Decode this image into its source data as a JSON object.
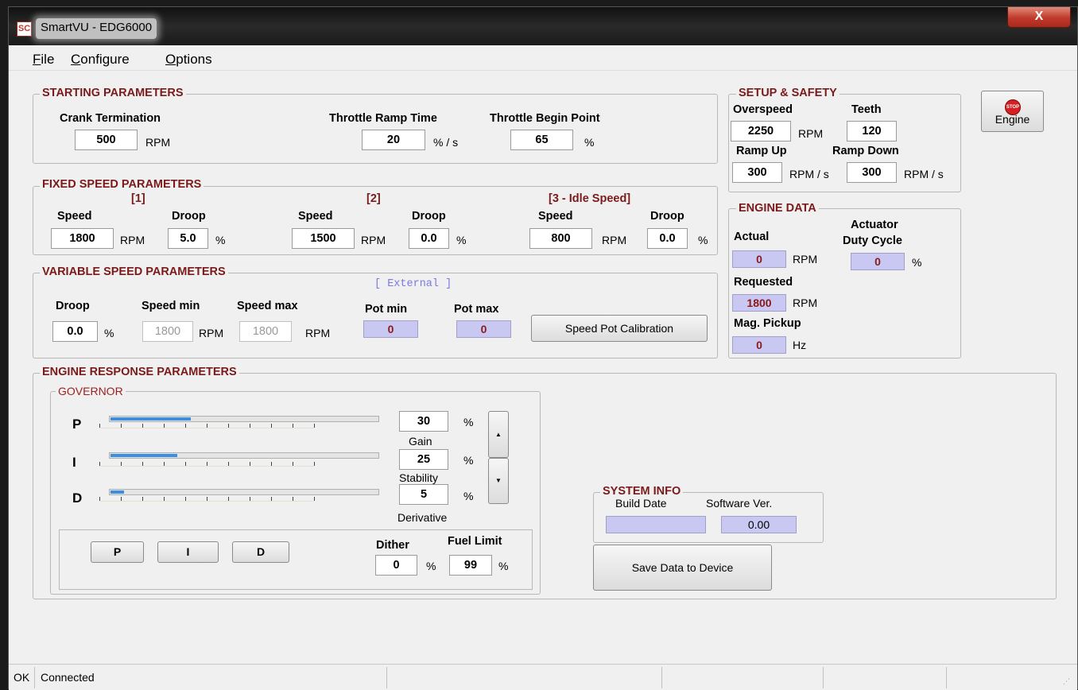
{
  "window": {
    "title": "SmartVU - EDG6000",
    "app_icon": "SC",
    "close": "X"
  },
  "menu": [
    {
      "label": "File",
      "mnemonic": "F"
    },
    {
      "label": "Configure",
      "mnemonic": "C"
    },
    {
      "label": "Options",
      "mnemonic": "O"
    }
  ],
  "starting": {
    "legend": "STARTING PARAMETERS",
    "crank_label": "Crank Termination",
    "crank_value": "500",
    "crank_unit": "RPM",
    "ramp_label": "Throttle Ramp Time",
    "ramp_value": "20",
    "ramp_unit": "% / s",
    "begin_label": "Throttle Begin Point",
    "begin_value": "65",
    "begin_unit": "%"
  },
  "setup": {
    "legend": "SETUP & SAFETY",
    "overspeed_label": "Overspeed",
    "overspeed_value": "2250",
    "overspeed_unit": "RPM",
    "teeth_label": "Teeth",
    "teeth_value": "120",
    "rampup_label": "Ramp Up",
    "rampup_value": "300",
    "rampup_unit": "RPM / s",
    "rampdown_label": "Ramp Down",
    "rampdown_value": "300",
    "rampdown_unit": "RPM / s"
  },
  "stop_engine": {
    "label": "Engine",
    "badge": "STOP"
  },
  "fixed": {
    "legend": "FIXED SPEED PARAMETERS",
    "sets": [
      {
        "title": "[1]",
        "speed_label": "Speed",
        "speed": "1800",
        "speed_unit": "RPM",
        "droop_label": "Droop",
        "droop": "5.0",
        "droop_unit": "%"
      },
      {
        "title": "[2]",
        "speed_label": "Speed",
        "speed": "1500",
        "speed_unit": "RPM",
        "droop_label": "Droop",
        "droop": "0.0",
        "droop_unit": "%"
      },
      {
        "title": "[3 - Idle Speed]",
        "speed_label": "Speed",
        "speed": "800",
        "speed_unit": "RPM",
        "droop_label": "Droop",
        "droop": "0.0",
        "droop_unit": "%"
      }
    ]
  },
  "engine_data": {
    "legend": "ENGINE DATA",
    "actual_label": "Actual",
    "actual_value": "0",
    "actual_unit": "RPM",
    "actuator_label_1": "Actuator",
    "actuator_label_2": "Duty Cycle",
    "actuator_value": "0",
    "actuator_unit": "%",
    "requested_label": "Requested",
    "requested_value": "1800",
    "requested_unit": "RPM",
    "mag_label": "Mag. Pickup",
    "mag_value": "0",
    "mag_unit": "Hz"
  },
  "variable": {
    "legend": "VARIABLE SPEED PARAMETERS",
    "mode": "[ External ]",
    "droop_label": "Droop",
    "droop_value": "0.0",
    "droop_unit": "%",
    "min_label": "Speed min",
    "min_value": "1800",
    "min_unit": "RPM",
    "max_label": "Speed max",
    "max_value": "1800",
    "max_unit": "RPM",
    "potmin_label": "Pot min",
    "potmin_value": "0",
    "potmax_label": "Pot max",
    "potmax_value": "0",
    "calibrate_label": "Speed Pot Calibration"
  },
  "response": {
    "legend": "ENGINE RESPONSE PARAMETERS",
    "governor_legend": "GOVERNOR",
    "p": {
      "label": "P",
      "value": "30",
      "unit": "%",
      "caption": "Gain",
      "level": 0.3
    },
    "i": {
      "label": "I",
      "value": "25",
      "unit": "%",
      "caption": "Stability",
      "level": 0.25
    },
    "d": {
      "label": "D",
      "value": "5",
      "unit": "%",
      "caption": "Derivative",
      "level": 0.05
    },
    "select_p": "P",
    "select_i": "I",
    "select_d": "D",
    "dither_label": "Dither",
    "dither_value": "0",
    "dither_unit": "%",
    "fuel_label": "Fuel Limit",
    "fuel_value": "99",
    "fuel_unit": "%",
    "up_arrow": "▲",
    "down_arrow": "▼"
  },
  "system_info": {
    "legend": "SYSTEM INFO",
    "build_label": "Build Date",
    "build_value": "",
    "software_label": "Software Ver.",
    "software_value": "0.00"
  },
  "save_label": "Save Data to Device",
  "status": {
    "state": "OK",
    "connection": "Connected"
  }
}
